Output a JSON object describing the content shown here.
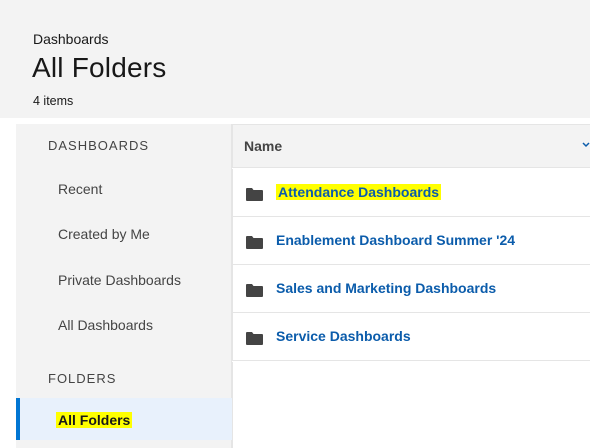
{
  "header": {
    "breadcrumb": "Dashboards",
    "title": "All Folders",
    "item_count": "4 items"
  },
  "sidebar": {
    "dashboards_heading": "DASHBOARDS",
    "items": [
      {
        "label": "Recent"
      },
      {
        "label": "Created by Me"
      },
      {
        "label": "Private Dashboards"
      },
      {
        "label": "All Dashboards"
      }
    ],
    "folders_heading": "FOLDERS",
    "active_item": "All Folders"
  },
  "table": {
    "column_name": "Name",
    "rows": [
      {
        "name": "Attendance Dashboards",
        "icon": "folder-icon",
        "highlighted": true
      },
      {
        "name": "Enablement Dashboard Summer '24",
        "icon": "folder-icon"
      },
      {
        "name": "Sales and Marketing Dashboards",
        "icon": "folder-icon"
      },
      {
        "name": "Service Dashboards",
        "icon": "folder-icon"
      }
    ]
  },
  "colors": {
    "link": "#0b5cab",
    "highlight": "#ffff00",
    "active_bg": "#e8f1fc",
    "active_border": "#0176d3",
    "panel_bg": "#f3f3f3"
  }
}
